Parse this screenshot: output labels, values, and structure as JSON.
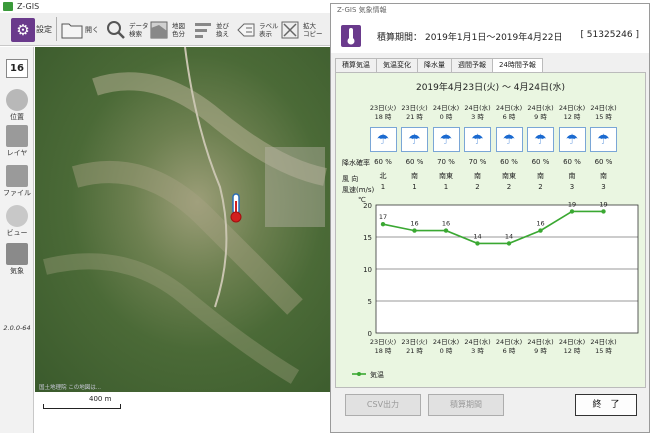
{
  "app": {
    "title": "Z-GIS",
    "toolbar": [
      {
        "label": "設定",
        "icon": "gear-icon"
      },
      {
        "label": "開く",
        "icon": "folder-icon"
      },
      {
        "label": "データ\n検索",
        "icon": "magnifier-icon"
      },
      {
        "label": "地図\n色分",
        "icon": "map-color-icon"
      },
      {
        "label": "並び\n換え",
        "icon": "sort-icon"
      },
      {
        "label": "ラベル\n表示",
        "icon": "label-icon"
      },
      {
        "label": "拡大\nコピー",
        "icon": "enlarge-copy-icon"
      }
    ],
    "sidebar": {
      "zoom": "16",
      "items": [
        {
          "label": "位置",
          "icon": "position-icon"
        },
        {
          "label": "レイヤ",
          "icon": "layer-icon"
        },
        {
          "label": "ファイル",
          "icon": "file-icon"
        },
        {
          "label": "ビュー",
          "icon": "eye-icon"
        },
        {
          "label": "気象",
          "icon": "thermometer-icon"
        }
      ],
      "version": "2.0.0-64"
    },
    "map": {
      "scale_label": "400 m",
      "marker_icon": "thermometer-marker-icon",
      "copyright": "国土地理院 この地図は..."
    }
  },
  "dialog": {
    "title": "Z-GIS 気象情報",
    "period_label": "積算期間：",
    "period_value": "2019年1月1日～2019年4月22日",
    "code": "[ 51325246 ]",
    "tabs": [
      "積算気温",
      "気温変化",
      "降水量",
      "週間予報",
      "24時間予報"
    ],
    "active_tab": 4,
    "forecast_title": "2019年4月23日(火) ～ 4月24日(水)",
    "times": [
      {
        "day": "23日(火)",
        "hour": "18 時"
      },
      {
        "day": "23日(火)",
        "hour": "21 時"
      },
      {
        "day": "24日(水)",
        "hour": "0 時"
      },
      {
        "day": "24日(水)",
        "hour": "3 時"
      },
      {
        "day": "24日(水)",
        "hour": "6 時"
      },
      {
        "day": "24日(水)",
        "hour": "9 時"
      },
      {
        "day": "24日(水)",
        "hour": "12 時"
      },
      {
        "day": "24日(水)",
        "hour": "15 時"
      }
    ],
    "weather_icon": "umbrella-rain-icon",
    "rain_label": "降水確率",
    "rain": [
      "60 %",
      "60 %",
      "70 %",
      "70 %",
      "60 %",
      "60 %",
      "60 %",
      "60 %"
    ],
    "wind_dir_label": "風 向",
    "wind_dir": [
      "北",
      "南",
      "南東",
      "南",
      "南東",
      "南",
      "南",
      "南"
    ],
    "wind_speed_label": "風速(m/s)",
    "wind_speed": [
      "1",
      "1",
      "1",
      "2",
      "2",
      "2",
      "3",
      "3"
    ],
    "buttons": {
      "csv": "CSV出力",
      "period": "積算期間",
      "close": "終　了"
    }
  },
  "chart_data": {
    "type": "line",
    "unit_label": "℃",
    "categories": [
      "23日(火) 18 時",
      "23日(火) 21 時",
      "24日(水) 0 時",
      "24日(水) 3 時",
      "24日(水) 6 時",
      "24日(水) 9 時",
      "24日(水) 12 時",
      "24日(水) 15 時"
    ],
    "series": [
      {
        "name": "気温",
        "values": [
          17,
          16,
          16,
          14,
          14,
          16,
          19,
          19
        ],
        "color": "#3aa832"
      }
    ],
    "ylim": [
      0,
      20
    ],
    "yticks": [
      0,
      5,
      10,
      15,
      20
    ],
    "grid": true,
    "legend": "bottom-left"
  }
}
